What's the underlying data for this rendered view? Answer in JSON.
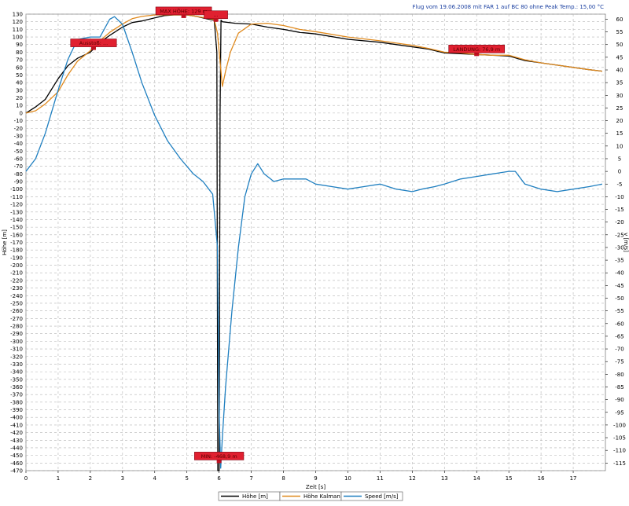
{
  "chart_data": {
    "type": "line",
    "title": "Flug vom 19.06.2008 mit FAR 1 auf BC 80 ohne Peak Temp.: 15,00 °C",
    "xlabel": "Zeit [s]",
    "ylabel_left": "Höhe [m]",
    "ylabel_right": "v [m/s]",
    "xlim": [
      0,
      18
    ],
    "ylim_left": [
      -470,
      130
    ],
    "ylim_right": [
      -118,
      62
    ],
    "x_ticks": [
      0,
      1,
      2,
      3,
      4,
      5,
      6,
      7,
      8,
      9,
      10,
      11,
      12,
      13,
      14,
      15,
      16,
      17
    ],
    "y_left_ticks": [
      130,
      120,
      110,
      100,
      90,
      80,
      70,
      60,
      50,
      40,
      30,
      20,
      10,
      0,
      -10,
      -20,
      -30,
      -40,
      -50,
      -60,
      -70,
      -80,
      -90,
      -100,
      -110,
      -120,
      -130,
      -140,
      -150,
      -160,
      -170,
      -180,
      -190,
      -200,
      -210,
      -220,
      -230,
      -240,
      -250,
      -260,
      -270,
      -280,
      -290,
      -300,
      -310,
      -320,
      -330,
      -340,
      -350,
      -360,
      -370,
      -380,
      -390,
      -400,
      -410,
      -420,
      -430,
      -440,
      -450,
      -460,
      -470
    ],
    "y_right_ticks": [
      60,
      55,
      50,
      45,
      40,
      35,
      30,
      25,
      20,
      15,
      10,
      5,
      0,
      -5,
      -10,
      -15,
      -20,
      -25,
      -30,
      -35,
      -40,
      -45,
      -50,
      -55,
      -60,
      -65,
      -70,
      -75,
      -80,
      -85,
      -90,
      -95,
      -100,
      -105,
      -110,
      -115
    ],
    "grid": true,
    "legend_position": "bottom-center",
    "series": [
      {
        "name": "Höhe [m]",
        "color": "#000000",
        "axis": "left",
        "x": [
          0,
          0.3,
          0.6,
          1.0,
          1.3,
          1.6,
          2.0,
          2.3,
          2.6,
          3.0,
          3.3,
          3.6,
          4.0,
          4.3,
          4.6,
          5.0,
          5.3,
          5.6,
          5.85,
          5.93,
          5.96,
          6.0,
          6.03,
          6.06,
          6.1,
          6.5,
          7.0,
          7.5,
          8.0,
          8.5,
          9.0,
          10.0,
          11.0,
          12.0,
          12.5,
          13.0,
          13.5,
          14.0,
          14.5,
          15.0,
          15.5,
          16.0,
          16.5,
          17.0,
          17.5,
          17.9
        ],
        "y": [
          0,
          8,
          18,
          45,
          62,
          72,
          80,
          93,
          102,
          113,
          119,
          121,
          125,
          128,
          129,
          129,
          127,
          124,
          122,
          80,
          -470,
          -470,
          0,
          122,
          120,
          118,
          117,
          113,
          110,
          106,
          104,
          97,
          93,
          87,
          84,
          79,
          78,
          77,
          76,
          75,
          69,
          66,
          63,
          60,
          57,
          55
        ]
      },
      {
        "name": "Höhe Kalman [m]",
        "color": "#e08a1e",
        "axis": "left",
        "x": [
          0,
          0.3,
          0.6,
          1.0,
          1.3,
          1.6,
          2.0,
          2.3,
          2.6,
          3.0,
          3.3,
          3.6,
          4.0,
          4.3,
          4.6,
          5.0,
          5.3,
          5.6,
          5.85,
          5.95,
          6.1,
          6.2,
          6.35,
          6.6,
          7.0,
          7.5,
          8.0,
          8.5,
          9.0,
          10.0,
          11.0,
          12.0,
          12.5,
          13.0,
          13.5,
          14.0,
          14.5,
          15.0,
          15.5,
          16.0,
          16.5,
          17.0,
          17.5,
          17.9
        ],
        "y": [
          0,
          3,
          12,
          28,
          50,
          68,
          82,
          95,
          106,
          117,
          124,
          127,
          129,
          129,
          129,
          129,
          127,
          125,
          123,
          105,
          35,
          55,
          80,
          105,
          117,
          118,
          115,
          110,
          107,
          100,
          95,
          89,
          85,
          80,
          79,
          77,
          76,
          76,
          70,
          66,
          63,
          60,
          57,
          55
        ]
      },
      {
        "name": "Speed [m/s]",
        "color": "#1f7fc0",
        "axis": "right",
        "x": [
          0,
          0.3,
          0.6,
          1.0,
          1.3,
          1.6,
          2.0,
          2.3,
          2.6,
          2.75,
          3.0,
          3.3,
          3.6,
          4.0,
          4.4,
          4.8,
          5.2,
          5.5,
          5.8,
          5.95,
          6.0,
          6.05,
          6.1,
          6.2,
          6.4,
          6.6,
          6.8,
          7.0,
          7.2,
          7.4,
          7.7,
          8.0,
          8.3,
          8.7,
          9.0,
          9.5,
          10.0,
          10.5,
          11.0,
          11.5,
          12.0,
          12.3,
          12.7,
          13.0,
          13.5,
          14.0,
          14.5,
          15.0,
          15.2,
          15.5,
          16.0,
          16.5,
          17.0,
          17.5,
          17.9
        ],
        "y": [
          0,
          5,
          15,
          32,
          44,
          52,
          53,
          53,
          60,
          61,
          58,
          47,
          35,
          22,
          12,
          5,
          -1,
          -4,
          -9,
          -30,
          -95,
          -117,
          -105,
          -85,
          -55,
          -30,
          -10,
          -1,
          3,
          -1,
          -4,
          -3,
          -3,
          -3,
          -5,
          -6,
          -7,
          -6,
          -5,
          -7,
          -8,
          -7,
          -6,
          -5,
          -3,
          -2,
          -1,
          0,
          0,
          -5,
          -7,
          -8,
          -7,
          -6,
          -5
        ]
      }
    ],
    "annotations": [
      {
        "text": "Ausstoß: ...",
        "x": 2.1,
        "y": 85
      },
      {
        "text": "MAX HÖHE: 129 m",
        "x": 4.9,
        "y": 127
      },
      {
        "text": "...",
        "x": 5.9,
        "y": 122
      },
      {
        "text": "MIN: -468,9 m",
        "x": 6.0,
        "y": -458
      },
      {
        "text": "LANDUNG: 76,9 m",
        "x": 14.0,
        "y": 77
      }
    ]
  }
}
